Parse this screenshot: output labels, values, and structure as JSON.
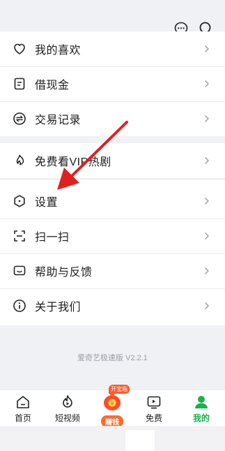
{
  "header": {
    "icons": [
      "chat-icon",
      "search-icon"
    ]
  },
  "menu": {
    "items": [
      {
        "label": "我的喜欢",
        "icon": "heart-icon"
      },
      {
        "label": "借现金",
        "icon": "document-icon"
      },
      {
        "label": "交易记录",
        "icon": "exchange-icon"
      },
      {
        "label": "免费看VIP热剧",
        "icon": "flame-icon"
      },
      {
        "label": "设置",
        "icon": "settings-hexagon-icon"
      },
      {
        "label": "扫一扫",
        "icon": "scan-icon"
      },
      {
        "label": "帮助与反馈",
        "icon": "feedback-icon"
      },
      {
        "label": "关于我们",
        "icon": "info-icon"
      }
    ]
  },
  "footer": {
    "version": "爱奇艺极速版 V2.2.1"
  },
  "tabbar": {
    "home": "首页",
    "short_video": "短视频",
    "earn": "赚钱",
    "earn_badge": "开宝箱",
    "free": "免费",
    "mine": "我的"
  },
  "colors": {
    "accent_green": "#18b24a",
    "annotation_red": "#e02020",
    "earn_orange": "#ff6a2c"
  }
}
